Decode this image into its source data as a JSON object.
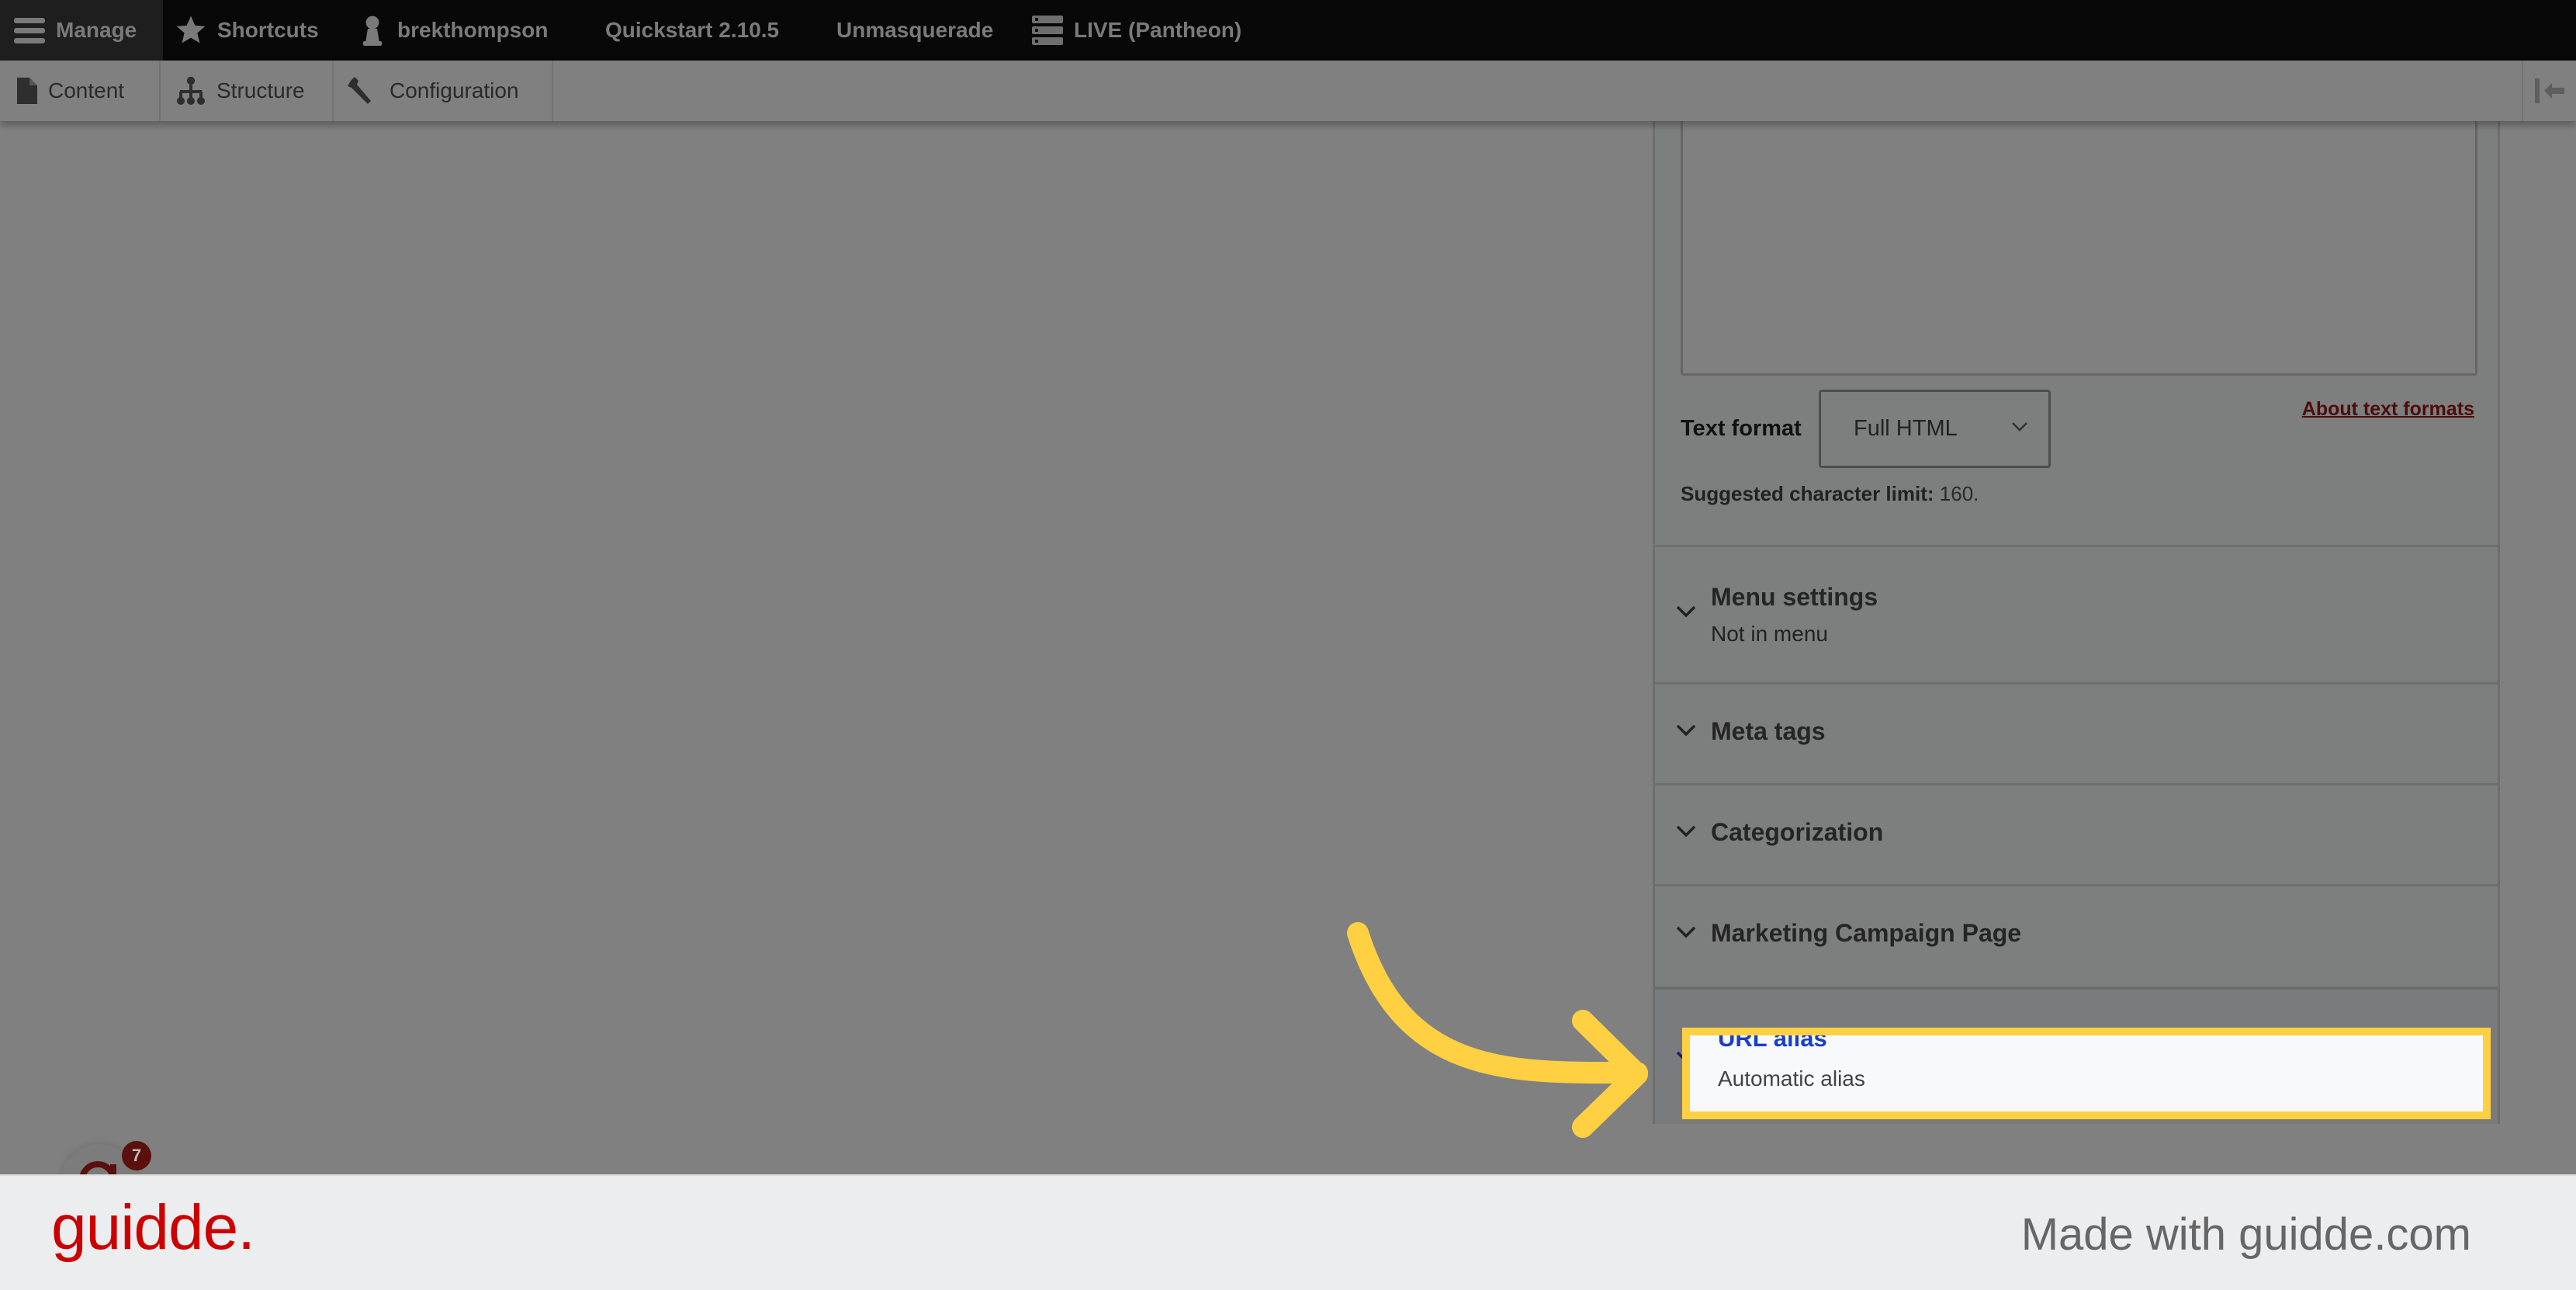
{
  "admin_toolbar": {
    "items": [
      {
        "label": "Manage",
        "icon": "hamburger-icon"
      },
      {
        "label": "Shortcuts",
        "icon": "star-icon"
      },
      {
        "label": "brekthompson",
        "icon": "user-icon"
      },
      {
        "label": "Quickstart 2.10.5"
      },
      {
        "label": "Unmasquerade"
      },
      {
        "label": "LIVE (Pantheon)",
        "icon": "server-icon"
      }
    ]
  },
  "secondary_toolbar": {
    "items": [
      {
        "label": "Content",
        "icon": "file-icon"
      },
      {
        "label": "Structure",
        "icon": "sitemap-icon"
      },
      {
        "label": "Configuration",
        "icon": "wrench-icon"
      }
    ],
    "collapse_icon": "collapse-left-icon"
  },
  "form": {
    "text_format_label": "Text format",
    "text_format_value": "Full HTML",
    "about_link": "About text formats",
    "limit_label": "Suggested character limit:",
    "limit_value": "160."
  },
  "sections": [
    {
      "title": "Menu settings",
      "summary": "Not in menu"
    },
    {
      "title": "Meta tags"
    },
    {
      "title": "Categorization"
    },
    {
      "title": "Marketing Campaign Page"
    },
    {
      "title": "URL alias",
      "summary": "Automatic alias",
      "highlighted": true
    }
  ],
  "badge": {
    "count": "7"
  },
  "footer": {
    "logo": "guidde.",
    "made_with": "Made with guidde.com"
  },
  "colors": {
    "highlight": "#ffd042",
    "link_active": "#1a3ec8",
    "brand": "#cc0000"
  }
}
